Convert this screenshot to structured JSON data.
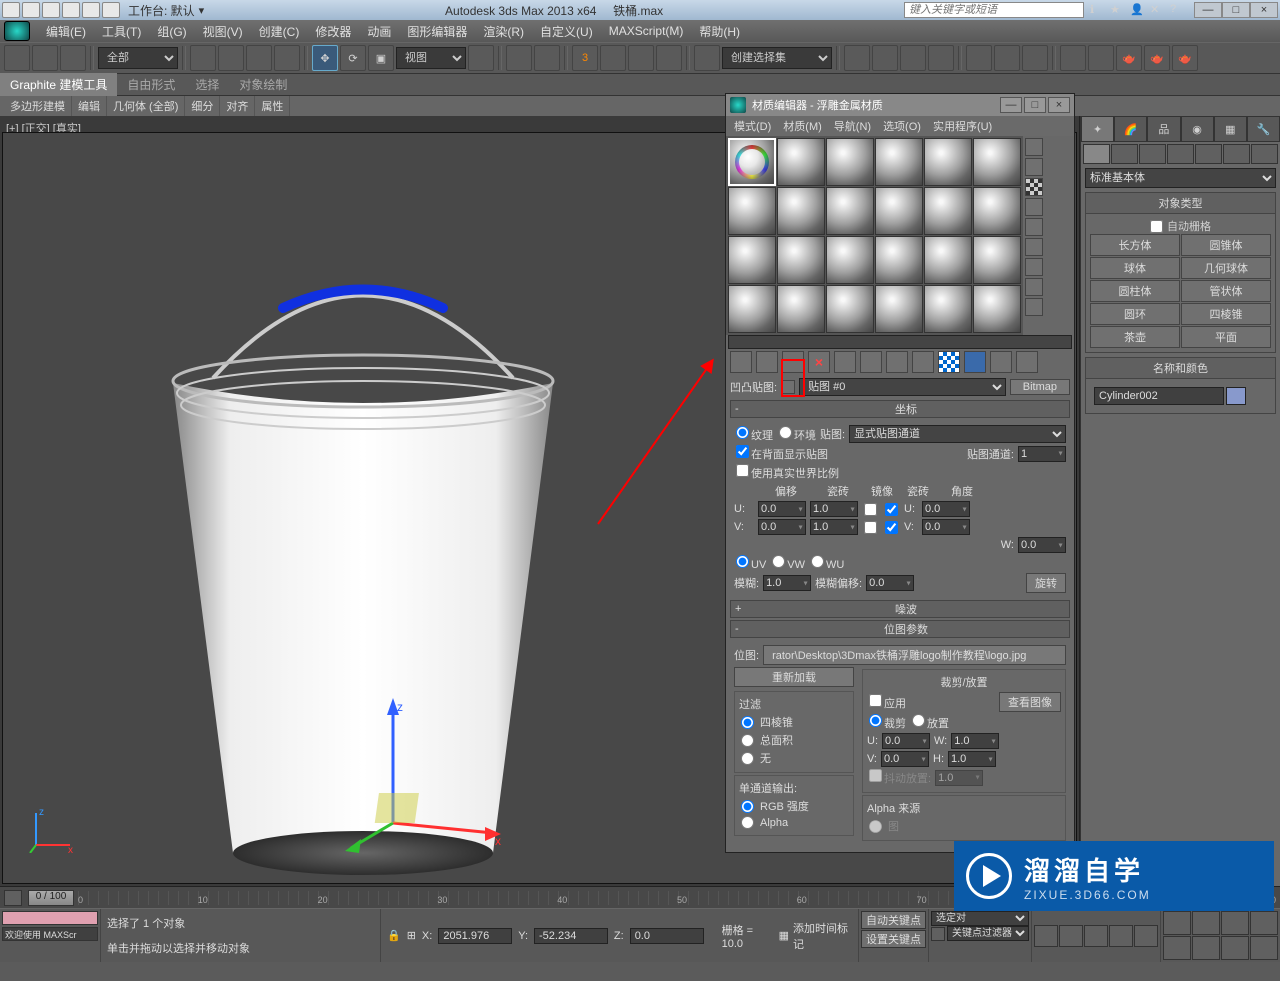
{
  "titlebar": {
    "workspace_label": "工作台: 默认",
    "app_title": "Autodesk 3ds Max  2013 x64",
    "doc_title": "铁桶.max",
    "search_placeholder": "键入关键字或短语",
    "min": "—",
    "max": "□",
    "close": "×"
  },
  "menubar": {
    "items": [
      "编辑(E)",
      "工具(T)",
      "组(G)",
      "视图(V)",
      "创建(C)",
      "修改器",
      "动画",
      "图形编辑器",
      "渲染(R)",
      "自定义(U)",
      "MAXScript(M)",
      "帮助(H)"
    ]
  },
  "toolbar": {
    "sel_filter": "全部",
    "coord_sys": "视图",
    "named_sel": "创建选择集"
  },
  "ribbon": {
    "tabs": [
      "Graphite 建模工具",
      "自由形式",
      "选择",
      "对象绘制"
    ],
    "sub": [
      "多边形建模",
      "编辑",
      "几何体 (全部)",
      "细分",
      "对齐",
      "属性"
    ]
  },
  "viewport": {
    "label": "[+] [正交] [真实]"
  },
  "material_editor": {
    "title": "材质编辑器 - 浮雕金属材质",
    "menu": [
      "模式(D)",
      "材质(M)",
      "导航(N)",
      "选项(O)",
      "实用程序(U)"
    ],
    "bump_label": "凹凸贴图:",
    "map_name": "贴图 #0",
    "map_type": "Bitmap",
    "coords": {
      "title": "坐标",
      "texture": "纹理",
      "env": "环境",
      "maplabel": "贴图:",
      "mapmode": "显式贴图通道",
      "showback": "在背面显示贴图",
      "mapchannel_lbl": "贴图通道:",
      "mapchannel": "1",
      "realworld": "使用真实世界比例",
      "offset": "偏移",
      "tiling": "瓷砖",
      "mirror": "镜像",
      "tile": "瓷砖",
      "angle": "角度",
      "u": "U:",
      "v": "V:",
      "w": "W:",
      "u_off": "0.0",
      "u_til": "1.0",
      "u_ang": "0.0",
      "v_off": "0.0",
      "v_til": "1.0",
      "v_ang": "0.0",
      "w_ang": "0.0",
      "uv": "UV",
      "vw": "VW",
      "wu": "WU",
      "blur_lbl": "模糊:",
      "blur": "1.0",
      "bluroff_lbl": "模糊偏移:",
      "bluroff": "0.0",
      "rotate": "旋转"
    },
    "noise": {
      "title": "噪波"
    },
    "bitmap": {
      "title": "位图参数",
      "path_lbl": "位图:",
      "path": "rator\\Desktop\\3Dmax铁桶浮雕logo制作教程\\logo.jpg",
      "reload": "重新加载",
      "filter_title": "过滤",
      "f_pyr": "四棱锥",
      "f_sum": "总面积",
      "f_none": "无",
      "mono_title": "单通道输出:",
      "m_rgb": "RGB 强度",
      "m_alpha": "Alpha",
      "crop_title": "裁剪/放置",
      "apply": "应用",
      "view": "查看图像",
      "crop": "裁剪",
      "place": "放置",
      "ul": "U:",
      "vl": "V:",
      "wl": "W:",
      "hl": "H:",
      "u": "0.0",
      "v": "0.0",
      "w": "1.0",
      "h": "1.0",
      "jitter": "抖动放置:",
      "jv": "1.0",
      "alpha_title": "Alpha 来源",
      "a_img": "图"
    }
  },
  "cmdpanel": {
    "dropdown": "标准基本体",
    "objtype_title": "对象类型",
    "autogrid": "自动栅格",
    "objs": [
      "长方体",
      "圆锥体",
      "球体",
      "几何球体",
      "圆柱体",
      "管状体",
      "圆环",
      "四棱锥",
      "茶壶",
      "平面"
    ],
    "namecolor_title": "名称和颜色",
    "name": "Cylinder002"
  },
  "time": {
    "slider": "0 / 100"
  },
  "status": {
    "welcome": "欢迎使用  MAXScr",
    "sel": "选择了 1 个对象",
    "hint": "单击并拖动以选择并移动对象",
    "x": "2051.976",
    "y": "-52.234",
    "z": "0.0",
    "grid": "栅格 = 10.0",
    "autokey": "自动关键点",
    "setkey": "设置关键点",
    "seldrop": "选定对",
    "kfilter": "关键点过滤器",
    "addtime": "添加时间标记"
  },
  "watermark": {
    "brand": "溜溜自学",
    "url": "ZIXUE.3D66.COM"
  }
}
